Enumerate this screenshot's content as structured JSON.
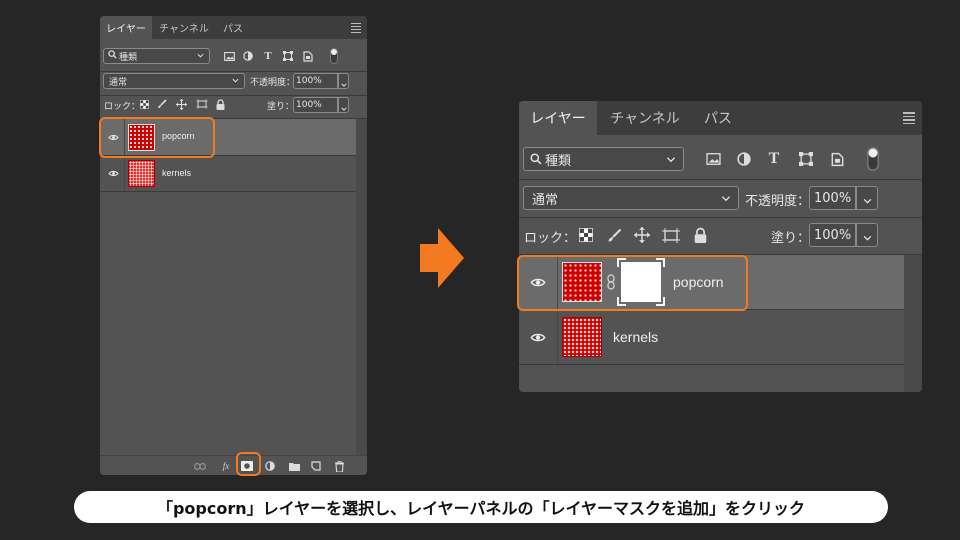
{
  "tabs": [
    "レイヤー",
    "チャンネル",
    "パス"
  ],
  "filter": {
    "label": "種類",
    "icons": [
      "image-filter-icon",
      "adjustment-filter-icon",
      "type-filter-icon",
      "shape-filter-icon",
      "smart-object-filter-icon",
      "filter-toggle-icon"
    ]
  },
  "blend": {
    "mode": "通常",
    "opacity_label": "不透明度：",
    "opacity_value": "100%"
  },
  "lock": {
    "label": "ロック：",
    "fill_label": "塗り：",
    "fill_value": "100%"
  },
  "layers": [
    {
      "name": "popcorn",
      "has_mask": true,
      "selected": true
    },
    {
      "name": "kernels",
      "has_mask": false,
      "selected": false
    }
  ],
  "footer_icons": [
    "link-layers-icon",
    "fx-icon",
    "add-mask-icon",
    "adjustment-layer-icon",
    "new-group-icon",
    "new-layer-icon",
    "trash-icon"
  ],
  "fx_label": "fx",
  "caption": "「popcorn」レイヤーを選択し、レイヤーパネルの「レイヤーマスクを追加」をクリック",
  "colors": {
    "highlight": "#f47a1f",
    "panel": "#535353",
    "background": "#262626"
  }
}
